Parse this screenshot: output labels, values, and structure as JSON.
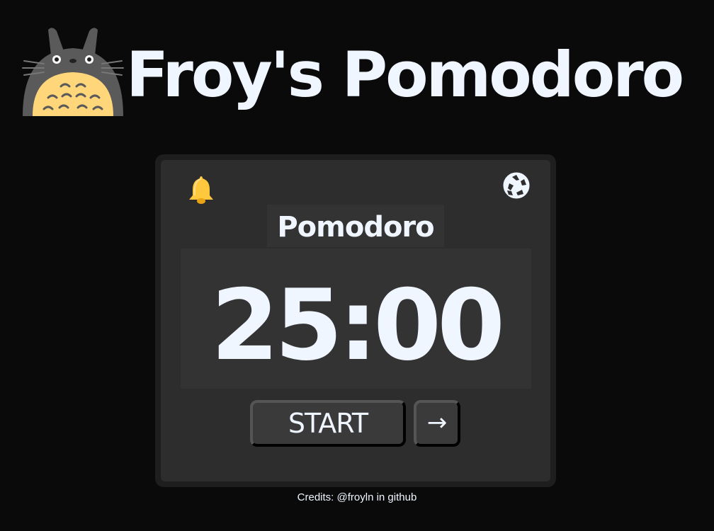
{
  "header": {
    "title": "Froy's Pomodoro",
    "logo_icon": "totoro-icon"
  },
  "card": {
    "alarm_icon": "bell-icon",
    "reset_icon": "recycle-icon",
    "mode_label": "Pomodoro",
    "timer": "25:00",
    "start_label": "START",
    "next_label": "→"
  },
  "footer": {
    "credits": "Credits: @froyln in github"
  },
  "colors": {
    "background": "#0a0a0a",
    "card_border": "#1e1e1e",
    "card": "#2d2d2d",
    "panel": "#333333",
    "text": "#f0f6ff",
    "bell": "#ffc83d",
    "totoro_body": "#5a5a5a",
    "totoro_belly": "#ffd77a"
  }
}
